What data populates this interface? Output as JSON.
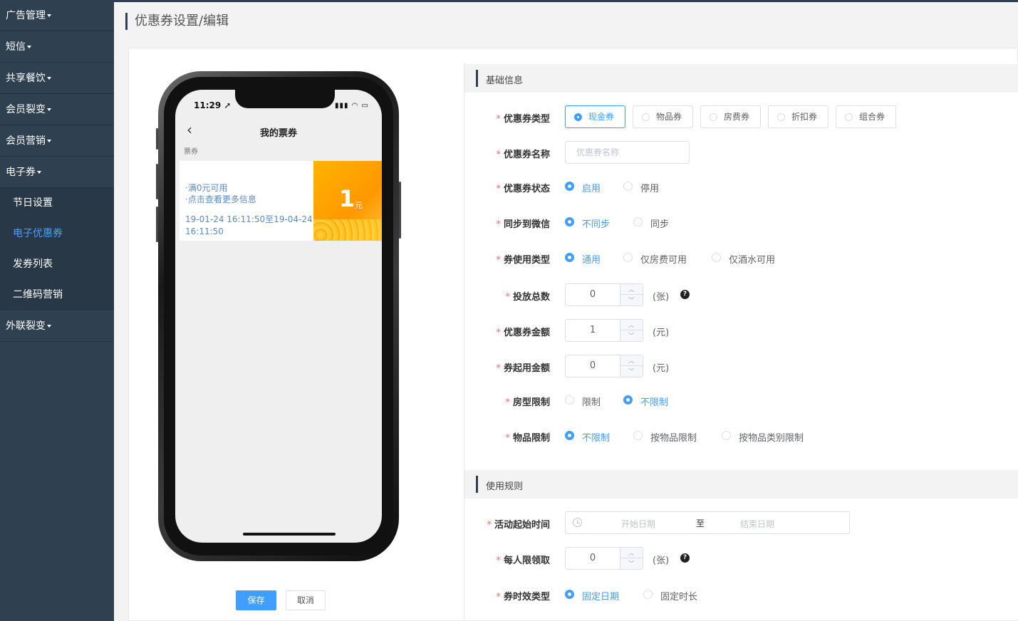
{
  "sidebar": {
    "items": [
      {
        "label": "广告管理"
      },
      {
        "label": "短信"
      },
      {
        "label": "共享餐饮"
      },
      {
        "label": "会员裂变"
      },
      {
        "label": "会员营销"
      },
      {
        "label": "电子券"
      }
    ],
    "sub_items": [
      {
        "label": "节日设置"
      },
      {
        "label": "电子优惠券"
      },
      {
        "label": "发券列表"
      },
      {
        "label": "二维码营销"
      }
    ],
    "last_item": {
      "label": "外联裂变"
    }
  },
  "page": {
    "title": "优惠券设置/编辑"
  },
  "phone": {
    "time": "11:29",
    "nav_title": "我的票券",
    "tab_label": "票券",
    "coupon": {
      "line1": "·满0元可用",
      "line2": "·点击查看更多信息",
      "validity": "19-01-24 16:11:50至19-04-24 16:11:50",
      "amount": "1",
      "unit": "元"
    }
  },
  "actions": {
    "save": "保存",
    "cancel": "取消"
  },
  "form": {
    "section_basic": "基础信息",
    "section_rules": "使用规则",
    "coupon_type": {
      "label": "优惠券类型",
      "options": [
        "现金券",
        "物品券",
        "房费券",
        "折扣券",
        "组合券"
      ],
      "selected": "现金券"
    },
    "coupon_name": {
      "label": "优惠券名称",
      "placeholder": "优惠券名称",
      "value": ""
    },
    "coupon_status": {
      "label": "优惠券状态",
      "options": [
        "启用",
        "停用"
      ],
      "selected": "启用"
    },
    "sync_wechat": {
      "label": "同步到微信",
      "options": [
        "不同步",
        "同步"
      ],
      "selected": "不同步"
    },
    "usage_type": {
      "label": "券使用类型",
      "options": [
        "通用",
        "仅房费可用",
        "仅酒水可用"
      ],
      "selected": "通用"
    },
    "total_issue": {
      "label": "投放总数",
      "value": "0",
      "unit": "(张)",
      "help": "?"
    },
    "coupon_amount": {
      "label": "优惠券金额",
      "value": "1",
      "unit": "(元)"
    },
    "min_amount": {
      "label": "券起用金额",
      "value": "0",
      "unit": "(元)"
    },
    "room_limit": {
      "label": "房型限制",
      "options": [
        "限制",
        "不限制"
      ],
      "selected": "不限制"
    },
    "item_limit": {
      "label": "物品限制",
      "options": [
        "不限制",
        "按物品限制",
        "按物品类别限制"
      ],
      "selected": "不限制"
    },
    "activity_time": {
      "label": "活动起始时间",
      "start_placeholder": "开始日期",
      "separator": "至",
      "end_placeholder": "结束日期"
    },
    "per_person": {
      "label": "每人限领取",
      "value": "0",
      "unit": "(张)",
      "help": "?"
    },
    "validity_type": {
      "label": "券时效类型",
      "options": [
        "固定日期",
        "固定时长"
      ],
      "selected": "固定日期"
    }
  },
  "colors": {
    "primary": "#409eff",
    "sidebar_bg": "#2f4050",
    "required": "#f56c6c",
    "coupon_orange": "#ff9800"
  }
}
